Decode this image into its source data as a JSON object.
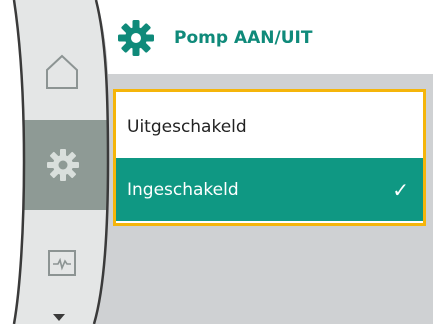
{
  "header": {
    "title": "Pomp AAN/UIT",
    "icon": "gear-icon"
  },
  "menu": {
    "options": [
      {
        "label": "Uitgeschakeld",
        "selected": false
      },
      {
        "label": "Ingeschakeld",
        "selected": true
      }
    ],
    "check_glyph": "✓"
  },
  "sidebar": {
    "items": [
      {
        "icon": "home-icon",
        "active": false
      },
      {
        "icon": "settings-gear-icon",
        "active": true
      },
      {
        "icon": "monitor-graph-icon",
        "active": false
      }
    ],
    "scroll_indicator": "chevron-down-icon"
  },
  "colors": {
    "accent": "#0f9883",
    "highlight_border": "#f5b50a",
    "panel_gray": "#cfd1d3",
    "sidebar_light": "#e4e6e6",
    "sidebar_active": "#8e9a95"
  }
}
